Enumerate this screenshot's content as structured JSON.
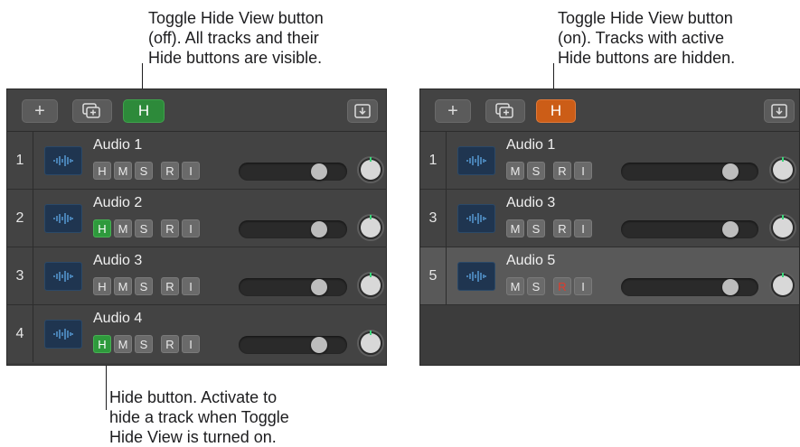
{
  "callouts": {
    "left_top": "Toggle Hide View button\n(off). All tracks and their\nHide buttons are visible.",
    "right_top": "Toggle Hide View button\n(on). Tracks with active\nHide buttons are hidden.",
    "bottom": "Hide button. Activate to\nhide a track when Toggle\nHide View is turned on."
  },
  "left_panel": {
    "toolbar": {
      "add": "+",
      "hide_toggle": "H",
      "hide_toggle_state": "off"
    },
    "tracks": [
      {
        "num": "1",
        "name": "Audio 1",
        "hide_active": false
      },
      {
        "num": "2",
        "name": "Audio 2",
        "hide_active": true
      },
      {
        "num": "3",
        "name": "Audio 3",
        "hide_active": false
      },
      {
        "num": "4",
        "name": "Audio 4",
        "hide_active": true
      }
    ]
  },
  "right_panel": {
    "toolbar": {
      "add": "+",
      "hide_toggle": "H",
      "hide_toggle_state": "on"
    },
    "tracks": [
      {
        "num": "1",
        "name": "Audio 1"
      },
      {
        "num": "3",
        "name": "Audio 3"
      },
      {
        "num": "5",
        "name": "Audio 5",
        "selected": true,
        "record_armed_red": true
      }
    ]
  },
  "buttons": {
    "h": "H",
    "m": "M",
    "s": "S",
    "r": "R",
    "i": "I"
  },
  "colors": {
    "hide_on": "#cc5d17",
    "hide_off": "#2d8a3a",
    "record_red": "#e23b2b"
  }
}
